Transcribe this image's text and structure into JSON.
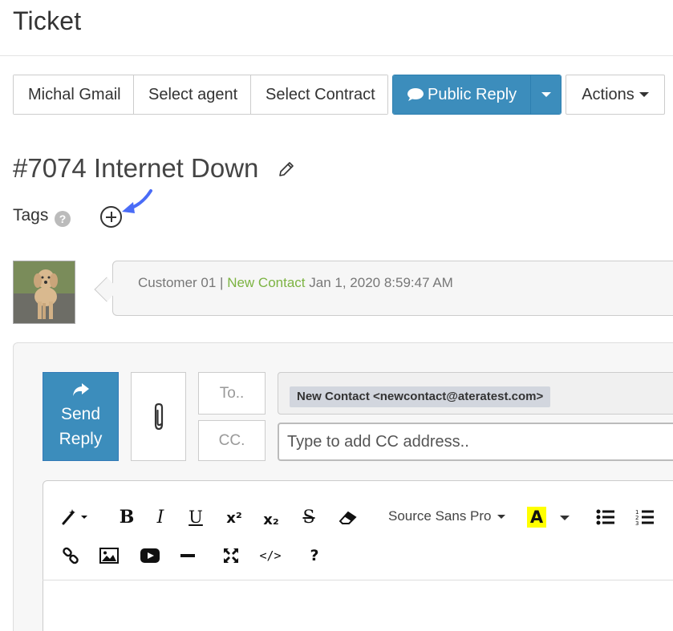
{
  "header": {
    "title": "Ticket"
  },
  "toolbar": {
    "contact_label": "Michal Gmail",
    "agent_label": "Select agent",
    "contract_label": "Select Contract",
    "public_reply_label": "Public Reply",
    "actions_label": "Actions",
    "public_reply_color": "#3c8dbc"
  },
  "ticket": {
    "title": "#7074 Internet Down"
  },
  "tags": {
    "label": "Tags",
    "help_glyph": "?"
  },
  "message": {
    "author": "Customer 01",
    "separator": " | ",
    "contact": "New Contact",
    "timestamp": " Jan 1, 2020 8:59:47 AM",
    "contact_color": "#7cb342"
  },
  "reply": {
    "send_line1": "Send",
    "send_line2": "Reply",
    "to_label": "To..",
    "cc_label": "CC.",
    "to_chip": "New Contact <newcontact@ateratest.com>",
    "cc_placeholder": "Type to add CC address.."
  },
  "editor": {
    "font_name": "Source Sans Pro",
    "tools_row1": [
      "magic-wand-icon",
      "bold-icon",
      "italic-icon",
      "underline-icon",
      "superscript-icon",
      "subscript-icon",
      "strikethrough-icon",
      "eraser-icon",
      "font-family-select",
      "highlight-color-icon",
      "bulleted-list-icon",
      "numbered-list-icon"
    ],
    "tools_row2": [
      "link-icon",
      "image-icon",
      "video-icon",
      "horizontal-rule-icon",
      "fullscreen-icon",
      "code-view-icon",
      "help-icon"
    ],
    "bold_glyph": "B",
    "italic_glyph": "I",
    "underline_glyph": "U",
    "superscript_glyph": "x²",
    "subscript_glyph": "x₂",
    "strike_glyph": "S",
    "highlight_glyph": "A",
    "code_glyph": "</>",
    "help_glyph": "?"
  }
}
